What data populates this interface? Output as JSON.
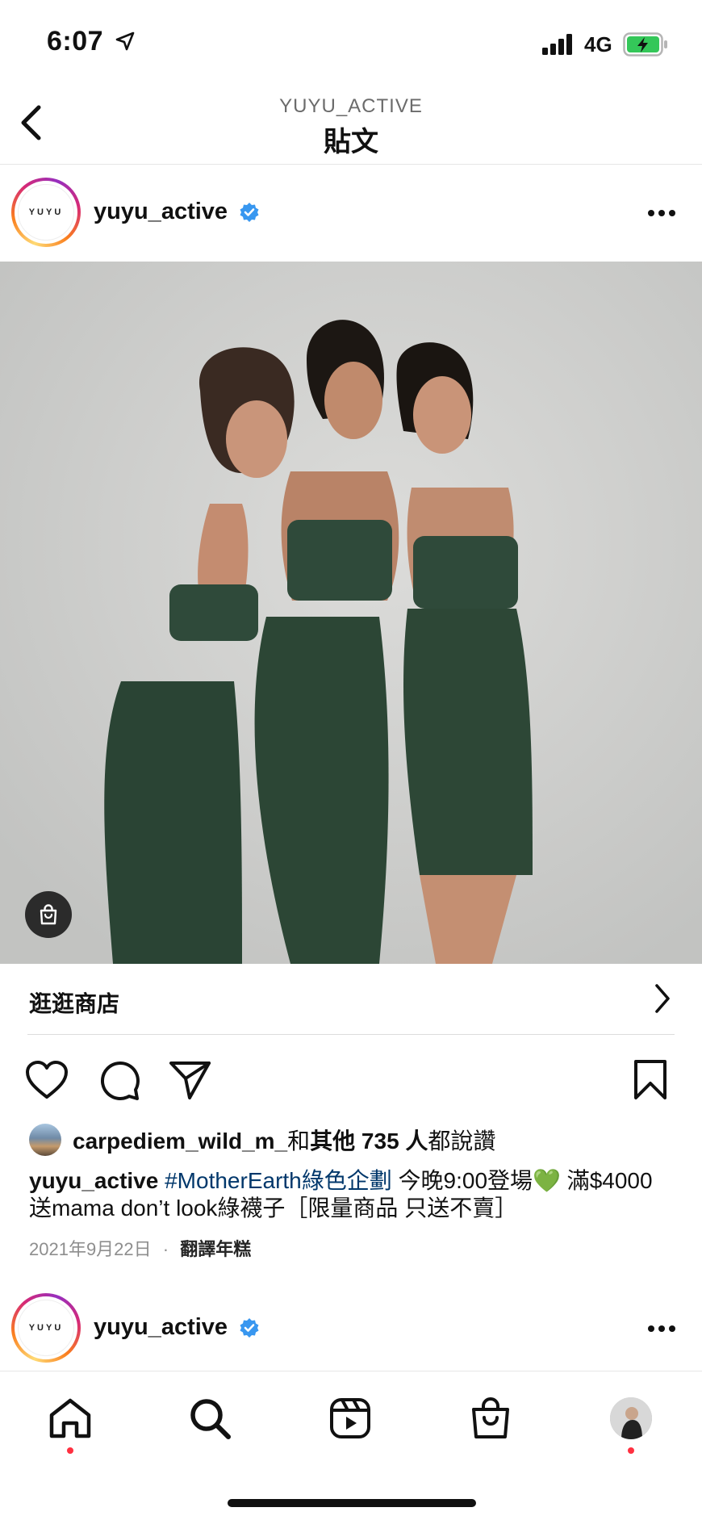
{
  "status_bar": {
    "time": "6:07",
    "network": "4G"
  },
  "header": {
    "account": "YUYU_ACTIVE",
    "title": "貼文"
  },
  "posts": [
    {
      "username": "yuyu_active",
      "avatar_text": "YUYU",
      "shop_label": "逛逛商店",
      "likes": {
        "liker": "carpediem_wild_m_",
        "prefix": "和",
        "others": "其他 735 人",
        "suffix": "都說讚"
      },
      "caption": {
        "user": "yuyu_active",
        "hashtag": "#MotherEarth綠色企劃",
        "text_1": " 今晚9:00登場",
        "emoji": "💚",
        "text_2": " 滿$4000送mama don’t look綠襪子［限量商品 只送不賣］"
      },
      "date": "2021年9月22日",
      "separator": "·",
      "translate_label": "翻譯年糕"
    },
    {
      "username": "yuyu_active",
      "avatar_text": "YUYU"
    }
  ],
  "colors": {
    "verified": "#3897f0",
    "hashtag": "#00376b",
    "notification_dot": "#ff3040",
    "outfit_green": "#2f4a3a"
  },
  "icons": {
    "back": "chevron-left-icon",
    "more": "more-horizontal-icon",
    "shop_tag": "shopping-bag-icon",
    "like": "heart-icon",
    "comment": "comment-icon",
    "share": "send-icon",
    "save": "bookmark-icon",
    "tabs": [
      "home-icon",
      "search-icon",
      "reels-icon",
      "shop-icon",
      "profile-avatar"
    ]
  }
}
